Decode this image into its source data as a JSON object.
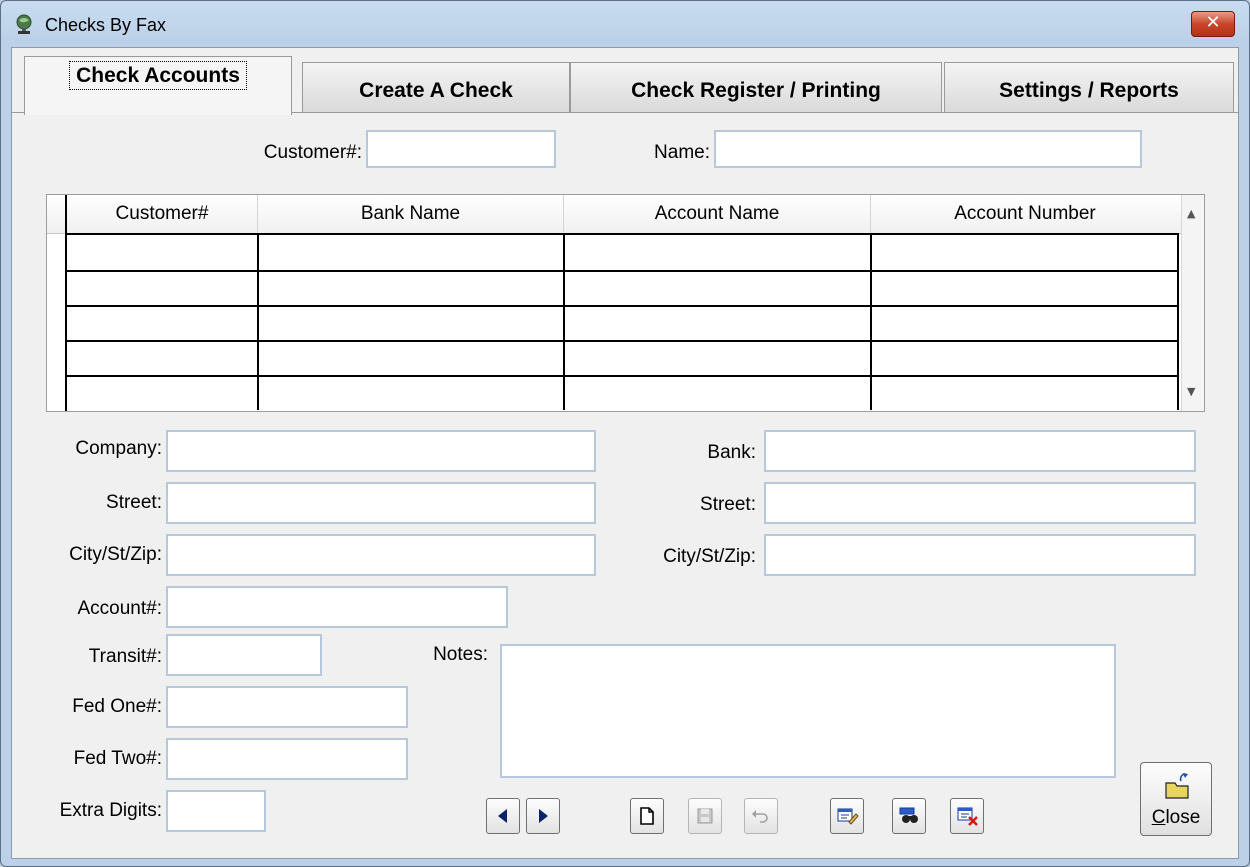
{
  "window": {
    "title": "Checks By Fax",
    "close_symbol": "✕"
  },
  "tabs": [
    {
      "label": "Check Accounts",
      "active": true
    },
    {
      "label": "Create A Check",
      "active": false
    },
    {
      "label": "Check Register / Printing",
      "active": false
    },
    {
      "label": "Settings / Reports",
      "active": false
    }
  ],
  "search": {
    "customer_label": "Customer#:",
    "customer_value": "",
    "name_label": "Name:",
    "name_value": ""
  },
  "grid": {
    "columns": [
      "Customer#",
      "Bank Name",
      "Account Name",
      "Account Number"
    ],
    "rows": [
      [
        "",
        "",
        "",
        ""
      ],
      [
        "",
        "",
        "",
        ""
      ],
      [
        "",
        "",
        "",
        ""
      ],
      [
        "",
        "",
        "",
        ""
      ],
      [
        "",
        "",
        "",
        ""
      ]
    ]
  },
  "form": {
    "company_label": "Company:",
    "street_label": "Street:",
    "city_label": "City/St/Zip:",
    "account_label": "Account#:",
    "transit_label": "Transit#:",
    "fedone_label": "Fed One#:",
    "fedtwo_label": "Fed Two#:",
    "extra_label": "Extra Digits:",
    "bank_label": "Bank:",
    "bank_street_label": "Street:",
    "bank_city_label": "City/St/Zip:",
    "notes_label": "Notes:",
    "company": "",
    "street": "",
    "city": "",
    "account": "",
    "transit": "",
    "fedone": "",
    "fedtwo": "",
    "extra": "",
    "bank": "",
    "bank_street": "",
    "bank_city": "",
    "notes": ""
  },
  "toolbar": {
    "close_label": "Close",
    "icons": [
      "prev-record-icon",
      "next-record-icon",
      "new-record-icon",
      "save-record-icon",
      "undo-icon",
      "edit-record-icon",
      "find-record-icon",
      "delete-record-icon",
      "close-folder-icon"
    ]
  },
  "colors": {
    "accent_blue": "#0a246a",
    "field_border": "#b7c7dc",
    "title_close_red": "#c8452a"
  }
}
